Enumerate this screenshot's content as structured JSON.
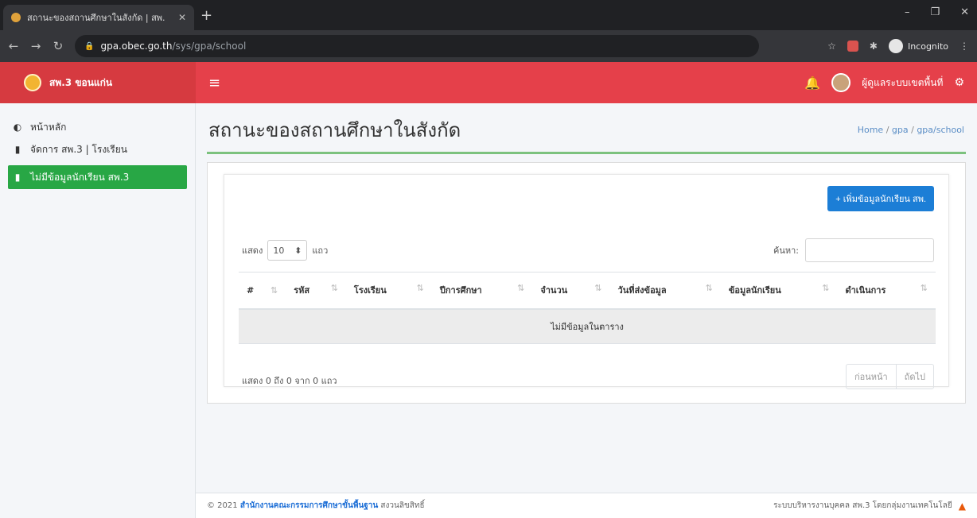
{
  "browser": {
    "tab_title": "สถานะของสถานศึกษาในสังกัด | สพ.",
    "tab_close": "✕",
    "new_tab": "+",
    "url_host": "gpa.obec.go.th",
    "url_path": "/sys/gpa/school",
    "profile_label": "Incognito",
    "win_min": "–",
    "win_max": "❐",
    "win_close": "✕"
  },
  "brand": {
    "name": "สพ.3 ขอนแก่น"
  },
  "topnav": {
    "user_name": "ผู้ดูแลระบบเขตพื้นที่"
  },
  "sidebar": {
    "items": [
      {
        "label": "หน้าหลัก",
        "icon": "dashboard-icon"
      },
      {
        "label": "จัดการ สพ.3 | โรงเรียน",
        "icon": "file-icon"
      },
      {
        "label": "ไม่มีข้อมูลนักเรียน สพ.3",
        "icon": "file-icon"
      }
    ]
  },
  "page": {
    "title": "สถานะของสถานศึกษาในสังกัด",
    "breadcrumb": [
      "Home",
      "gpa",
      "gpa/school"
    ]
  },
  "card": {
    "add_button": "+ เพิ่มข้อมูลนักเรียน สพ.",
    "length_prefix": "แสดง",
    "length_value": "10",
    "length_suffix": "แถว",
    "search_label": "ค้นหา:",
    "columns": [
      "#",
      "รหัส",
      "โรงเรียน",
      "ปีการศึกษา",
      "จำนวน",
      "วันที่ส่งข้อมูล",
      "ข้อมูลนักเรียน",
      "ดำเนินการ"
    ],
    "empty_text": "ไม่มีข้อมูลในตาราง",
    "info_text": "แสดง 0 ถึง 0 จาก 0 แถว",
    "prev_label": "ก่อนหน้า",
    "next_label": "ถัดไป"
  },
  "footer": {
    "copyright": "© 2021",
    "org": "สำนักงานคณะกรรมการศึกษาขั้นพื้นฐาน",
    "rights": "สงวนลิขสิทธิ์",
    "right_text": "ระบบบริหารงานบุคคล สพ.3 โดยกลุ่มงานเทคโนโลยี"
  },
  "colors": {
    "brand_red": "#e5404a",
    "active_green": "#28a745",
    "primary_blue": "#1c7ed6",
    "underline_green": "#7cc27e"
  }
}
